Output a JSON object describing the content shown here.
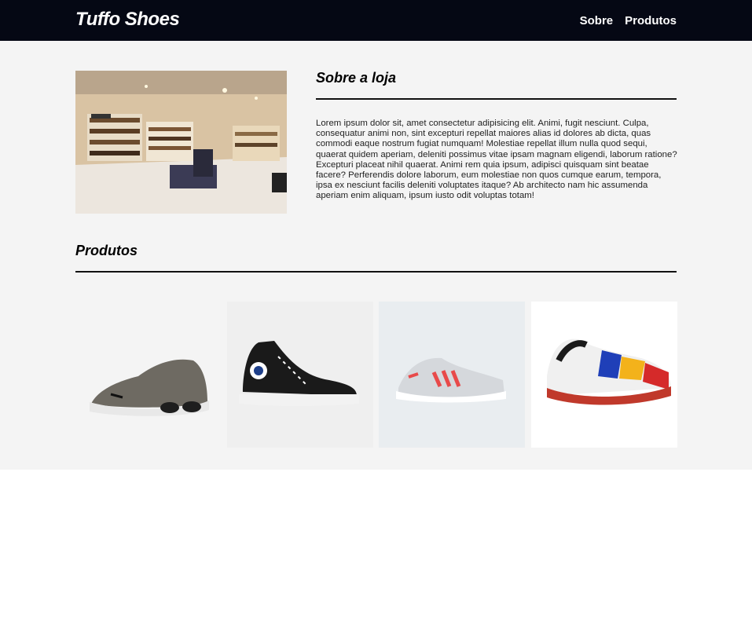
{
  "header": {
    "brand": "Tuffo Shoes",
    "nav": [
      "Sobre",
      "Produtos"
    ]
  },
  "about": {
    "title": "Sobre a loja",
    "image": "store-interior-photo",
    "text": "Lorem ipsum dolor sit, amet consectetur adipisicing elit. Animi, fugit nesciunt. Culpa, consequatur animi non, sint excepturi repellat maiores alias id dolores ab dicta, quas commodi eaque nostrum fugiat numquam! Molestiae repellat illum nulla quod sequi, quaerat quidem aperiam, deleniti possimus vitae ipsam magnam eligendi, laborum ratione? Excepturi placeat nihil quaerat. Animi rem quia ipsum, adipisci quisquam sint beatae facere? Perferendis dolore laborum, eum molestiae non quos cumque earum, tempora, ipsa ex nesciunt facilis deleniti voluptates itaque? Ab architecto nam hic assumenda aperiam enim aliquam, ipsum iusto odit voluptas totam!"
  },
  "products": {
    "title": "Produtos",
    "items": [
      {
        "image": "grey-running-sneaker"
      },
      {
        "image": "black-high-top-canvas-sneaker"
      },
      {
        "image": "white-red-running-sneaker"
      },
      {
        "image": "colorful-chunky-sneaker"
      }
    ]
  },
  "colors": {
    "header_bg": "#050814",
    "section_bg": "#f4f4f4",
    "text": "#222222"
  }
}
